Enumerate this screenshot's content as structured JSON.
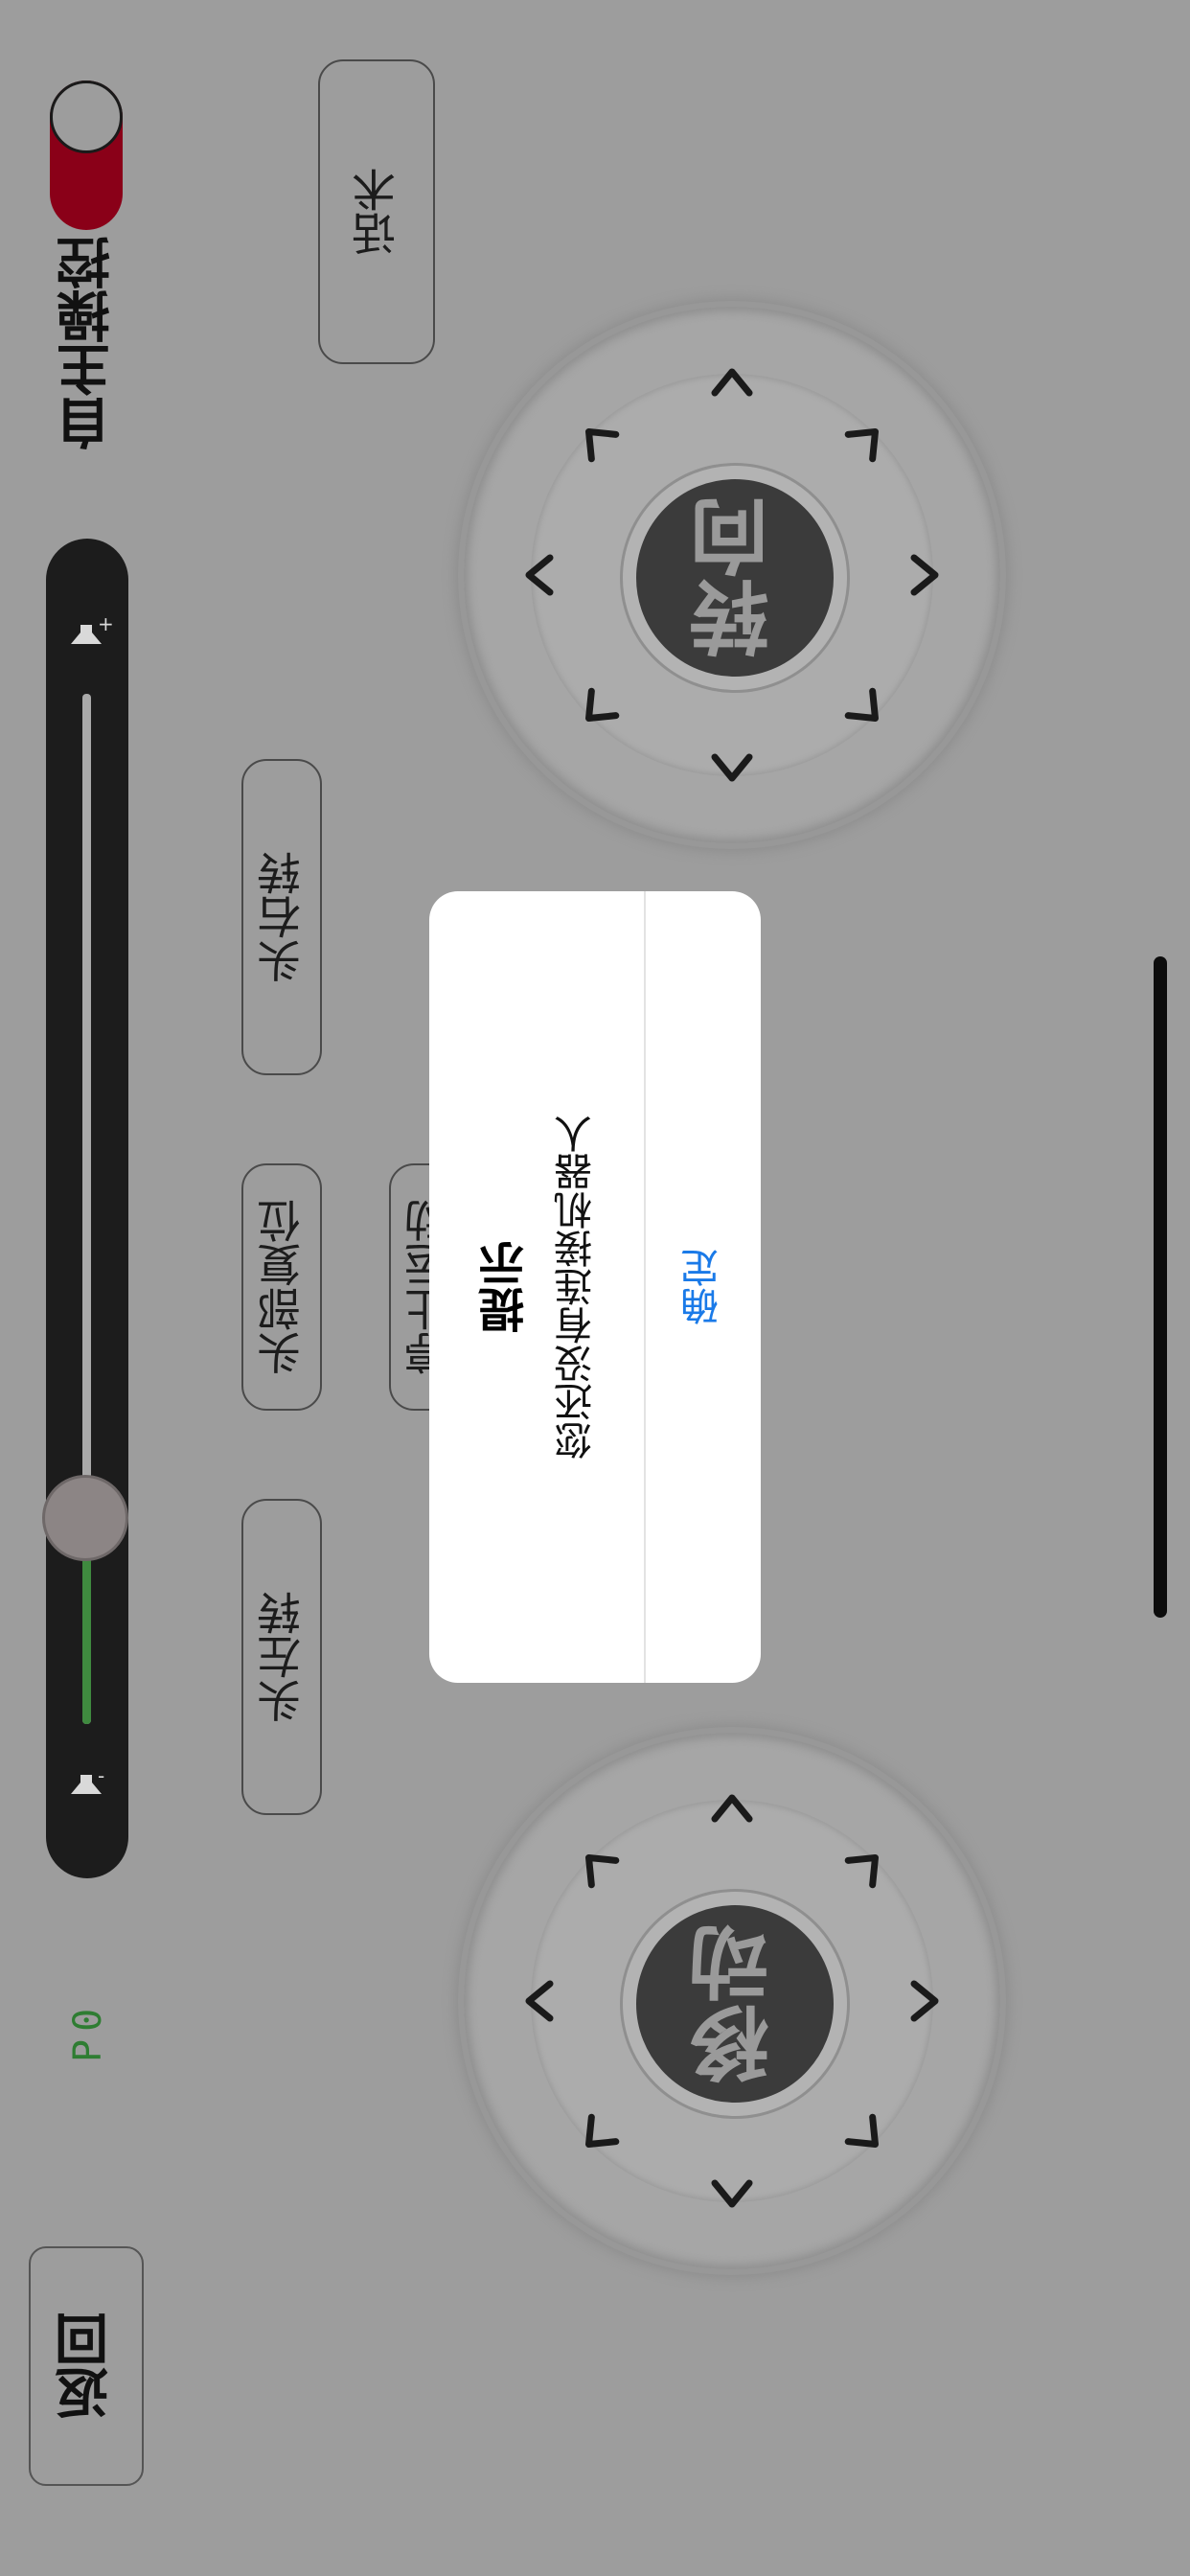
{
  "toggle": {
    "label": "自主操控",
    "on": true,
    "color": "#8a0018"
  },
  "script_button": {
    "label": "话术"
  },
  "volume": {
    "plus_symbol": "+",
    "minus_symbol": "-",
    "level": 0.2,
    "fill_color": "#3f8a3f"
  },
  "status": {
    "p_value": "P0"
  },
  "head_buttons": {
    "right": "头右转",
    "reset": "头部复位",
    "left": "头左转",
    "stop": "停止运动"
  },
  "joystick_turn": {
    "label": "转向"
  },
  "joystick_move": {
    "label": "移动"
  },
  "arrows": {
    "glyph": ">"
  },
  "back_button": {
    "label": "返回"
  },
  "dialog": {
    "title": "提示",
    "message": "您还没有连接机器人",
    "ok_label": "确定",
    "ok_color": "#1a7ae8"
  }
}
